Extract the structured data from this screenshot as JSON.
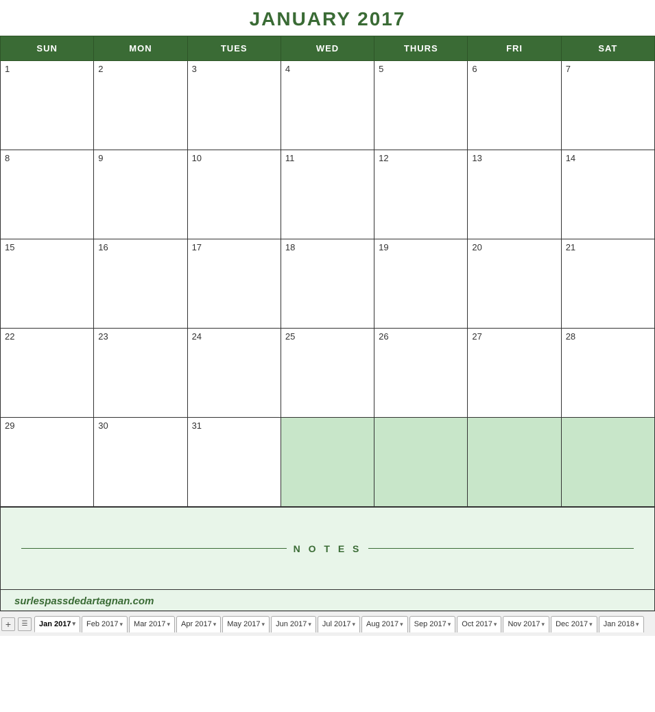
{
  "title": "JANUARY 2017",
  "header": {
    "days": [
      "SUN",
      "MON",
      "TUES",
      "WED",
      "THURS",
      "FRI",
      "SAT"
    ]
  },
  "weeks": [
    {
      "days": [
        {
          "num": "1",
          "type": "current"
        },
        {
          "num": "2",
          "type": "current"
        },
        {
          "num": "3",
          "type": "current"
        },
        {
          "num": "4",
          "type": "current"
        },
        {
          "num": "5",
          "type": "current"
        },
        {
          "num": "6",
          "type": "current"
        },
        {
          "num": "7",
          "type": "current"
        }
      ]
    },
    {
      "days": [
        {
          "num": "8",
          "type": "current"
        },
        {
          "num": "9",
          "type": "current"
        },
        {
          "num": "10",
          "type": "current"
        },
        {
          "num": "11",
          "type": "current"
        },
        {
          "num": "12",
          "type": "current"
        },
        {
          "num": "13",
          "type": "current"
        },
        {
          "num": "14",
          "type": "current"
        }
      ]
    },
    {
      "days": [
        {
          "num": "15",
          "type": "current"
        },
        {
          "num": "16",
          "type": "current"
        },
        {
          "num": "17",
          "type": "current"
        },
        {
          "num": "18",
          "type": "current"
        },
        {
          "num": "19",
          "type": "current"
        },
        {
          "num": "20",
          "type": "current"
        },
        {
          "num": "21",
          "type": "current"
        }
      ]
    },
    {
      "days": [
        {
          "num": "22",
          "type": "current"
        },
        {
          "num": "23",
          "type": "current"
        },
        {
          "num": "24",
          "type": "current"
        },
        {
          "num": "25",
          "type": "current"
        },
        {
          "num": "26",
          "type": "current"
        },
        {
          "num": "27",
          "type": "current"
        },
        {
          "num": "28",
          "type": "current"
        }
      ]
    },
    {
      "days": [
        {
          "num": "29",
          "type": "current"
        },
        {
          "num": "30",
          "type": "current"
        },
        {
          "num": "31",
          "type": "current"
        },
        {
          "num": "",
          "type": "next-month"
        },
        {
          "num": "",
          "type": "next-month"
        },
        {
          "num": "",
          "type": "next-month"
        },
        {
          "num": "",
          "type": "next-month"
        }
      ]
    }
  ],
  "notes_label": "N O T E S",
  "watermark": "surlespassdedartagnan.com",
  "tabs": [
    {
      "label": "Jan 2017",
      "active": true
    },
    {
      "label": "Feb 2017",
      "active": false
    },
    {
      "label": "Mar 2017",
      "active": false
    },
    {
      "label": "Apr 2017",
      "active": false
    },
    {
      "label": "May 2017",
      "active": false
    },
    {
      "label": "Jun 2017",
      "active": false
    },
    {
      "label": "Jul 2017",
      "active": false
    },
    {
      "label": "Aug 2017",
      "active": false
    },
    {
      "label": "Sep 2017",
      "active": false
    },
    {
      "label": "Oct 2017",
      "active": false
    },
    {
      "label": "Nov 2017",
      "active": false
    },
    {
      "label": "Dec 2017",
      "active": false
    },
    {
      "label": "Jan 2018",
      "active": false
    }
  ]
}
